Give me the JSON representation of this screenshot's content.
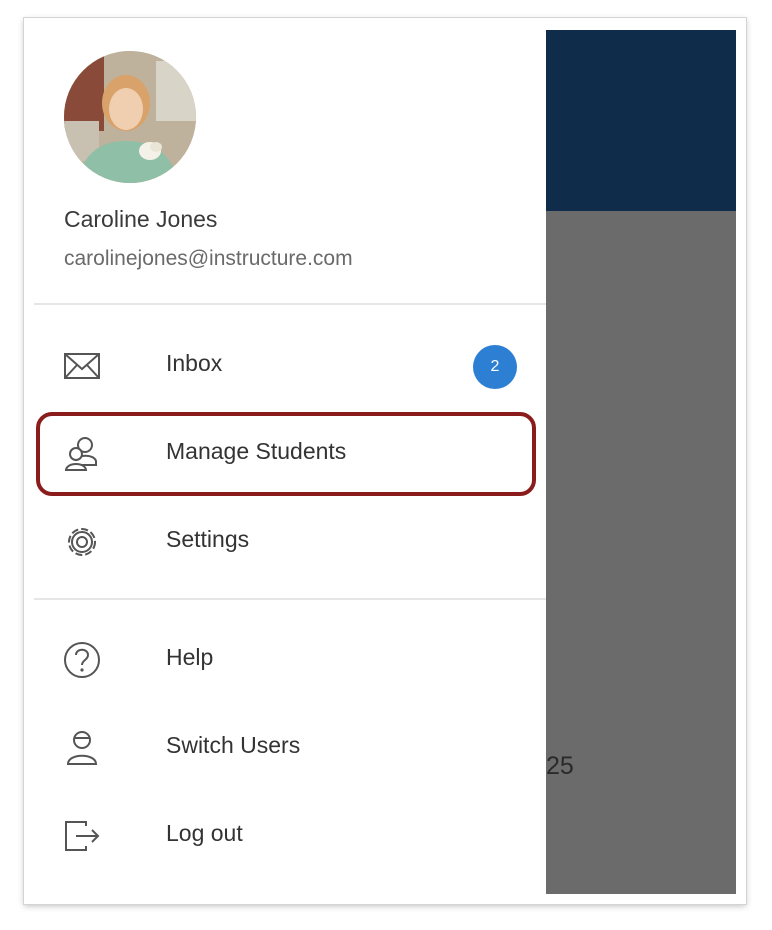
{
  "user": {
    "name": "Caroline Jones",
    "email": "carolinejones@instructure.com"
  },
  "menu_primary": [
    {
      "label": "Inbox",
      "icon": "mail-icon",
      "badge": "2"
    },
    {
      "label": "Manage Students",
      "icon": "manage-students-icon",
      "highlighted": true
    },
    {
      "label": "Settings",
      "icon": "gear-icon"
    }
  ],
  "menu_secondary": [
    {
      "label": "Help",
      "icon": "help-icon"
    },
    {
      "label": "Switch Users",
      "icon": "switch-users-icon"
    },
    {
      "label": "Log out",
      "icon": "logout-icon"
    }
  ],
  "background_app": {
    "partial_text": "25"
  },
  "colors": {
    "badge": "#2d7fd3",
    "highlight": "#8b1c1c",
    "header": "#0f2c4a",
    "overlay": "#6b6b6b"
  }
}
